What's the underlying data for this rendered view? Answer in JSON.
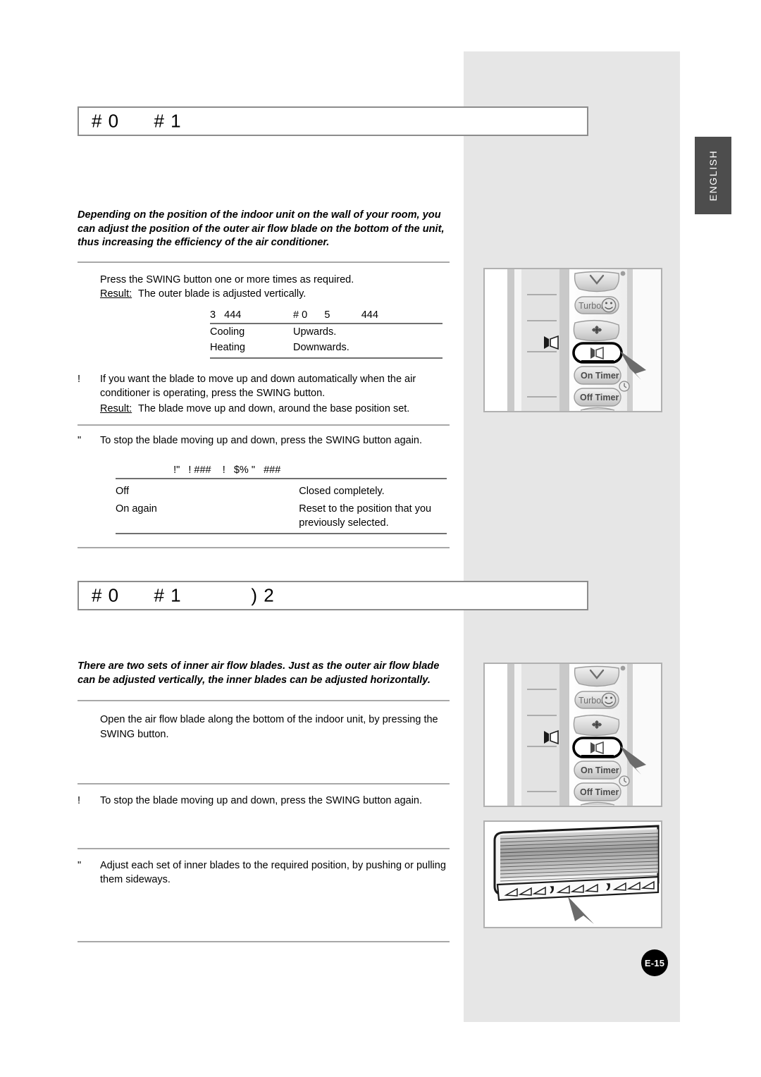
{
  "page": {
    "badge": "E-15",
    "language_tab": "ENGLISH"
  },
  "sections": [
    {
      "heading": "# 0      # 1",
      "intro": "Depending on the position of the indoor unit on the wall of your room, you can adjust the position of the outer air flow blade on the bottom of the unit, thus increasing the efficiency of the air conditioner.",
      "steps": [
        {
          "num": "",
          "text": "Press the SWING button one or more times as required.",
          "result_label": "Result:",
          "result_text": "The outer blade is adjusted vertically."
        },
        {
          "num": "!",
          "text": "If you want the blade to move up and down automatically when the air conditioner is operating, press the SWING button.",
          "result_label": "Result:",
          "result_text": "The blade move up and down, around the base position set."
        },
        {
          "num": "\"",
          "text": "To stop the blade moving up and down, press the SWING button again.",
          "result_label": "",
          "result_text": ""
        }
      ],
      "table_swing": {
        "headers": [
          "3   444",
          "# 0      5           444"
        ],
        "rows": [
          [
            "Cooling",
            "Upwards."
          ],
          [
            "Heating",
            "Downwards."
          ]
        ]
      },
      "table_power": {
        "headers": [
          "!\"   ! ###    !   $% \"   ###",
          ""
        ],
        "rows": [
          [
            "Off",
            "Closed completely."
          ],
          [
            "On again",
            "Reset to the position that you previously selected."
          ]
        ]
      }
    },
    {
      "heading": "# 0      # 1            ) 2",
      "intro": "There are two sets of inner air flow blades. Just as the outer air flow blade can be adjusted vertically, the inner blades can be adjusted horizontally.",
      "steps": [
        {
          "num": "",
          "text": "Open the air flow blade along the bottom of the indoor unit, by pressing the SWING button."
        },
        {
          "num": "!",
          "text": "To stop the blade moving up and down, press the SWING button again."
        },
        {
          "num": "\"",
          "text": "Adjust each set of inner blades to the required position, by pushing or pulling them sideways."
        }
      ]
    }
  ],
  "illustrations": {
    "remote": {
      "buttons": [
        {
          "label": "",
          "icon": "chevron-down-icon"
        },
        {
          "label": "Turbo/",
          "icon": "smiley-face-icon"
        },
        {
          "label": "",
          "icon": "fan-speed-icon"
        },
        {
          "label": "",
          "icon": "swing-blade-icon"
        },
        {
          "label": "On Timer",
          "icon": ""
        },
        {
          "label": "Off Timer",
          "icon": "clock-icon"
        }
      ],
      "highlighted_button": "swing-button",
      "display_icon": "swing-blade-icon"
    },
    "indoor_unit": {
      "caption": "",
      "pointer": "inner-blades-arrow"
    }
  },
  "colors": {
    "panel_gray": "#e6e6e6",
    "tab_dark": "#4d4d4d",
    "rule_gray": "#a8a8a8",
    "box_border": "#b0b0b0",
    "badge_black": "#000000"
  }
}
